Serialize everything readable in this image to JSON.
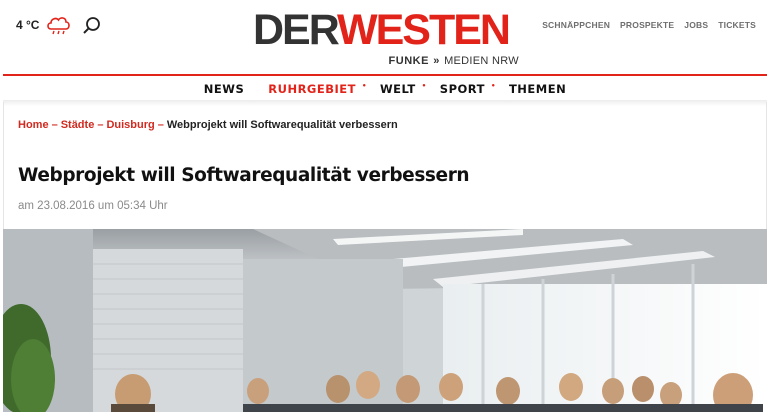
{
  "header": {
    "temperature": "4 °C",
    "weather_icon": "cloud-rain-icon",
    "search_icon": "search-icon",
    "logo": {
      "part1": "DER",
      "part2": "WESTEN",
      "sub_brand": "FUNKE",
      "sub_chevrons": "»",
      "sub_region": "MEDIEN NRW"
    },
    "top_links": [
      "SCHNÄPPCHEN",
      "PROSPEKTE",
      "JOBS",
      "TICKETS"
    ]
  },
  "nav": {
    "items": [
      {
        "label": "NEWS",
        "active": false,
        "dot": false
      },
      {
        "label": "RUHRGEBIET",
        "active": true,
        "dot": true
      },
      {
        "label": "WELT",
        "active": false,
        "dot": true
      },
      {
        "label": "SPORT",
        "active": false,
        "dot": true
      },
      {
        "label": "THEMEN",
        "active": false,
        "dot": false
      }
    ]
  },
  "breadcrumb": {
    "links": [
      "Home",
      "Städte",
      "Duisburg"
    ],
    "separator": "–",
    "current": "Webprojekt will Softwarequalität verbessern"
  },
  "article": {
    "title": "Webprojekt will Softwarequalität verbessern",
    "date": "am 23.08.2016 um 05:34 Uhr"
  },
  "colors": {
    "brand_red": "#e2231a",
    "link_red": "#d12a1f",
    "logo_dark": "#333333"
  }
}
